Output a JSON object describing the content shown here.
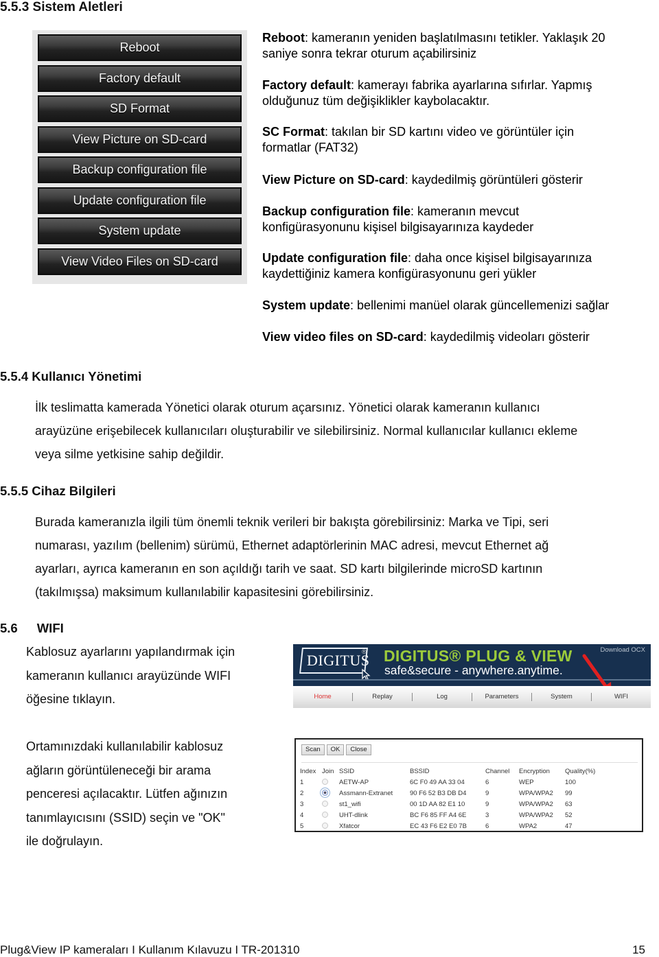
{
  "sections": {
    "system_tools": {
      "heading": "5.5.3 Sistem Aletleri"
    },
    "user_management": {
      "heading": "5.5.4 Kullanıcı Yönetimi",
      "lines": [
        "İlk teslimatta kamerada Yönetici olarak oturum açarsınız. Yönetici olarak kameranın kullanıcı",
        "arayüzüne erişebilecek kullanıcıları oluşturabilir ve silebilirsiniz. Normal kullanıcılar kullanıcı ekleme",
        "veya silme yetkisine sahip değildir."
      ]
    },
    "device_info": {
      "heading": "5.5.5 Cihaz Bilgileri",
      "lines": [
        "Burada kameranızla ilgili tüm önemli teknik verileri bir bakışta görebilirsiniz: Marka ve Tipi, seri",
        "numarası, yazılım (bellenim) sürümü, Ethernet adaptörlerinin MAC adresi, mevcut Ethernet ağ",
        "ayarları, ayrıca kameranın en son açıldığı tarih ve saat. SD kartı bilgilerinde microSD kartının",
        "(takılmışsa) maksimum kullanılabilir kapasitesini görebilirsiniz."
      ]
    },
    "wifi": {
      "number": "5.6",
      "title": "WIFI",
      "para1": [
        "Kablosuz ayarlarını yapılandırmak için",
        "kameranın kullanıcı arayüzünde WIFI",
        "öğesine tıklayın."
      ],
      "para2": [
        "Ortamınızdaki kullanılabilir kablosuz",
        "ağların görüntüleneceği bir arama",
        "penceresi açılacaktır. Lütfen ağınızın",
        "tanımlayıcısını (SSID) seçin ve \"OK\"",
        "ile doğrulayın."
      ]
    }
  },
  "tool_buttons": [
    "Reboot",
    "Factory default",
    "SD Format",
    "View Picture on SD-card",
    "Backup configuration file",
    "Update configuration file",
    "System update",
    "View Video Files on SD-card"
  ],
  "descriptions": [
    {
      "term": "Reboot",
      "lines": [
        ": kameranın yeniden başlatılmasını tetikler. Yaklaşık 20",
        "saniye sonra tekrar oturum açabilirsiniz"
      ]
    },
    {
      "term": "Factory default",
      "lines": [
        ": kamerayı fabrika ayarlarına sıfırlar. Yapmış",
        "olduğunuz tüm değişiklikler kaybolacaktır."
      ]
    },
    {
      "term": "SC Format",
      "lines": [
        ": takılan bir SD kartını video ve görüntüler için",
        "formatlar (FAT32)"
      ]
    },
    {
      "term": "View Picture on SD-card",
      "lines": [
        ": kaydedilmiş görüntüleri gösterir"
      ]
    },
    {
      "term": "Backup configuration file",
      "lines": [
        ": kameranın mevcut",
        "konfigürasyonunu kişisel bilgisayarınıza kaydeder"
      ]
    },
    {
      "term": "Update configuration file",
      "lines": [
        ": daha once kişisel bilgisayarınıza",
        "kaydettiğiniz kamera konfigürasyonunu geri yükler"
      ]
    },
    {
      "term": "System update",
      "lines": [
        ": bellenimi manüel olarak güncellemenizi sağlar"
      ]
    },
    {
      "term": "View video files on SD-card",
      "lines": [
        ": kaydedilmiş videoları gösterir"
      ]
    }
  ],
  "banner": {
    "logo": "DIGITUS",
    "logo_reg": "®",
    "title": "DIGITUS® PLUG & VIEW",
    "subtitle": "safe&secure - anywhere.anytime.",
    "download_link": "Download OCX",
    "nav": [
      "Home",
      "Replay",
      "Log",
      "Parameters",
      "System",
      "WIFI"
    ],
    "active_nav": "Home",
    "colors": {
      "header_bg": "#17304f",
      "brand_green": "#9ccb3b",
      "arrow": "#e02020",
      "active_nav": "#dd3333"
    }
  },
  "scan_dialog": {
    "buttons": [
      "Scan",
      "OK",
      "Close"
    ],
    "columns": [
      "Index",
      "Join",
      "SSID",
      "BSSID",
      "Channel",
      "Encryption",
      "Quality(%)"
    ],
    "rows": [
      {
        "index": "1",
        "joined": false,
        "ssid": "AETW-AP",
        "bssid": "6C F0 49 AA 33 04",
        "channel": "6",
        "encryption": "WEP",
        "quality": "100"
      },
      {
        "index": "2",
        "joined": true,
        "ssid": "Assmann-Extranet",
        "bssid": "90 F6 52 B3 DB D4",
        "channel": "9",
        "encryption": "WPA/WPA2",
        "quality": "99"
      },
      {
        "index": "3",
        "joined": false,
        "ssid": "st1_wifi",
        "bssid": "00 1D AA 82 E1 10",
        "channel": "9",
        "encryption": "WPA/WPA2",
        "quality": "63"
      },
      {
        "index": "4",
        "joined": false,
        "ssid": "UHT-dlink",
        "bssid": "BC F6 85 FF A4 6E",
        "channel": "3",
        "encryption": "WPA/WPA2",
        "quality": "52"
      },
      {
        "index": "5",
        "joined": false,
        "ssid": "Xfatcor",
        "bssid": "EC 43 F6 E2 E0 7B",
        "channel": "6",
        "encryption": "WPA2",
        "quality": "47"
      }
    ]
  },
  "footer": {
    "left": "Plug&View IP kameraları I Kullanım Kılavuzu I TR-201310",
    "page": "15"
  }
}
